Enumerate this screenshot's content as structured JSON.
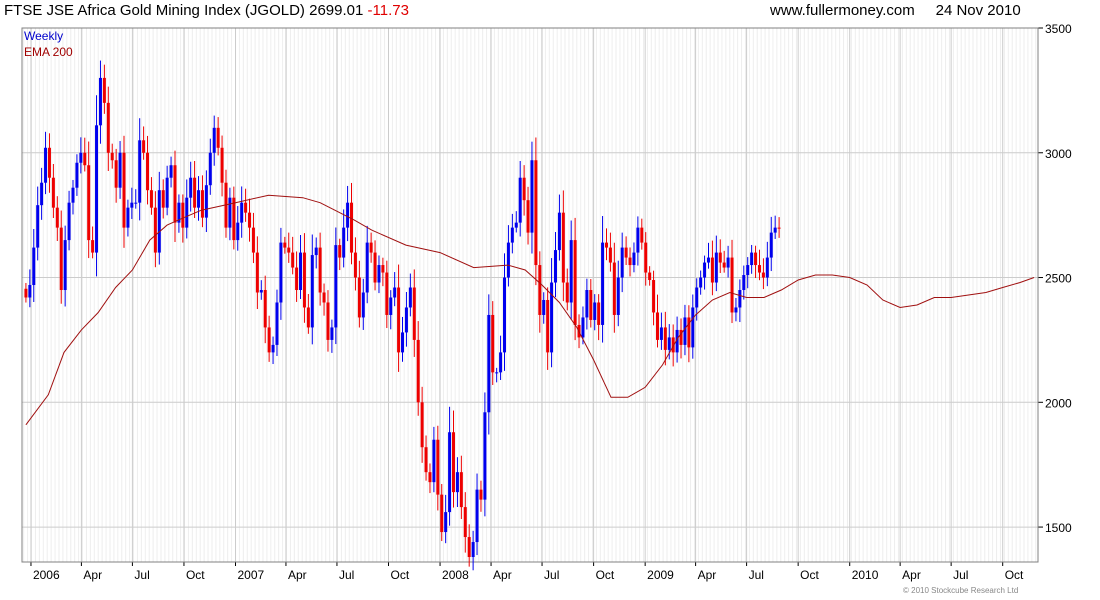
{
  "header": {
    "title": "FTSE JSE Africa Gold Mining Index (JGOLD)",
    "last": "2699.01",
    "change": "-11.73",
    "site": "www.fullermoney.com",
    "date": "24 Nov 2010"
  },
  "legend": {
    "weekly": "Weekly",
    "ema": "EMA 200"
  },
  "copyright": "© 2010 Stockcube Research Ltd",
  "colors": {
    "up": "#0000ee",
    "down": "#ee0000",
    "ema": "#a01010",
    "grid": "#cccccc",
    "border": "#808080"
  },
  "chart_data": {
    "type": "candlestick",
    "grid": true,
    "ylim": [
      1360,
      3500
    ],
    "xlim": [
      "2005-12-16",
      "2010-12-03"
    ],
    "yticks": [
      1500,
      2000,
      2500,
      3000,
      3500
    ],
    "xticks": [
      {
        "label": "2006",
        "date": "2006-01-01"
      },
      {
        "label": "Apr",
        "date": "2006-04-01"
      },
      {
        "label": "Jul",
        "date": "2006-07-01"
      },
      {
        "label": "Oct",
        "date": "2006-10-01"
      },
      {
        "label": "2007",
        "date": "2007-01-01"
      },
      {
        "label": "Apr",
        "date": "2007-04-01"
      },
      {
        "label": "Jul",
        "date": "2007-07-01"
      },
      {
        "label": "Oct",
        "date": "2007-10-01"
      },
      {
        "label": "2008",
        "date": "2008-01-01"
      },
      {
        "label": "Apr",
        "date": "2008-04-01"
      },
      {
        "label": "Jul",
        "date": "2008-07-01"
      },
      {
        "label": "Oct",
        "date": "2008-10-01"
      },
      {
        "label": "2009",
        "date": "2009-01-01"
      },
      {
        "label": "Apr",
        "date": "2009-04-01"
      },
      {
        "label": "Jul",
        "date": "2009-07-01"
      },
      {
        "label": "Oct",
        "date": "2009-10-01"
      },
      {
        "label": "2010",
        "date": "2010-01-01"
      },
      {
        "label": "Apr",
        "date": "2010-04-01"
      },
      {
        "label": "Jul",
        "date": "2010-07-01"
      },
      {
        "label": "Oct",
        "date": "2010-10-01"
      }
    ],
    "weekly": {
      "interval": "weekly",
      "start": "2005-12-23",
      "close": [
        2420,
        2470,
        2620,
        2790,
        2880,
        3020,
        2900,
        2780,
        2700,
        2450,
        2650,
        2800,
        2860,
        2960,
        3000,
        2950,
        2650,
        2600,
        3110,
        3300,
        3200,
        3000,
        2970,
        2860,
        3000,
        2700,
        2780,
        2800,
        2800,
        3050,
        3000,
        2850,
        2780,
        2600,
        2850,
        2780,
        2900,
        2950,
        2720,
        2800,
        2700,
        2820,
        2900,
        2780,
        2850,
        2740,
        2870,
        3000,
        3100,
        3020,
        2880,
        2700,
        2820,
        2650,
        2720,
        2800,
        2760,
        2700,
        2600,
        2440,
        2450,
        2300,
        2200,
        2230,
        2400,
        2640,
        2620,
        2600,
        2540,
        2450,
        2600,
        2380,
        2300,
        2590,
        2620,
        2440,
        2400,
        2250,
        2300,
        2630,
        2580,
        2700,
        2800,
        2600,
        2500,
        2340,
        2440,
        2640,
        2600,
        2480,
        2550,
        2520,
        2350,
        2420,
        2460,
        2200,
        2280,
        2380,
        2460,
        2250,
        2000,
        1820,
        1720,
        1680,
        1850,
        1630,
        1480,
        1560,
        1880,
        1640,
        1720,
        1580,
        1460,
        1380,
        1440,
        1650,
        1610,
        1960,
        2350,
        2120,
        2120,
        2200,
        2500,
        2640,
        2700,
        2720,
        2900,
        2810,
        2680,
        2970,
        2550,
        2350,
        2410,
        2200,
        2480,
        2610,
        2760,
        2480,
        2400,
        2650,
        2310,
        2260,
        2340,
        2450,
        2330,
        2400,
        2310,
        2640,
        2620,
        2560,
        2350,
        2500,
        2620,
        2580,
        2550,
        2600,
        2700,
        2640,
        2520,
        2490,
        2360,
        2250,
        2300,
        2210,
        2260,
        2200,
        2290,
        2230,
        2340,
        2220,
        2380,
        2460,
        2500,
        2560,
        2580,
        2480,
        2600,
        2560,
        2540,
        2580,
        2360,
        2380,
        2450,
        2510,
        2550,
        2600,
        2550,
        2520,
        2500,
        2580,
        2680,
        2700,
        2699
      ]
    },
    "ema200": {
      "points": [
        [
          "2005-12-23",
          1910
        ],
        [
          "2006-02-01",
          2030
        ],
        [
          "2006-03-01",
          2200
        ],
        [
          "2006-04-01",
          2290
        ],
        [
          "2006-05-01",
          2360
        ],
        [
          "2006-06-01",
          2460
        ],
        [
          "2006-07-01",
          2530
        ],
        [
          "2006-08-01",
          2650
        ],
        [
          "2006-09-01",
          2710
        ],
        [
          "2006-10-01",
          2740
        ],
        [
          "2006-11-01",
          2770
        ],
        [
          "2007-01-01",
          2800
        ],
        [
          "2007-03-01",
          2830
        ],
        [
          "2007-05-01",
          2820
        ],
        [
          "2007-06-01",
          2800
        ],
        [
          "2007-08-01",
          2730
        ],
        [
          "2007-09-01",
          2690
        ],
        [
          "2007-11-01",
          2630
        ],
        [
          "2008-01-01",
          2600
        ],
        [
          "2008-03-01",
          2540
        ],
        [
          "2008-05-01",
          2550
        ],
        [
          "2008-06-01",
          2530
        ],
        [
          "2008-07-01",
          2470
        ],
        [
          "2008-08-01",
          2400
        ],
        [
          "2008-09-01",
          2300
        ],
        [
          "2008-10-01",
          2170
        ],
        [
          "2008-11-01",
          2020
        ],
        [
          "2008-12-01",
          2020
        ],
        [
          "2009-01-01",
          2060
        ],
        [
          "2009-02-01",
          2150
        ],
        [
          "2009-03-01",
          2260
        ],
        [
          "2009-04-01",
          2350
        ],
        [
          "2009-05-01",
          2410
        ],
        [
          "2009-06-01",
          2440
        ],
        [
          "2009-07-01",
          2420
        ],
        [
          "2009-08-01",
          2420
        ],
        [
          "2009-09-01",
          2450
        ],
        [
          "2009-10-01",
          2490
        ],
        [
          "2009-11-01",
          2510
        ],
        [
          "2009-12-01",
          2510
        ],
        [
          "2010-01-01",
          2500
        ],
        [
          "2010-02-01",
          2470
        ],
        [
          "2010-03-01",
          2410
        ],
        [
          "2010-04-01",
          2380
        ],
        [
          "2010-05-01",
          2390
        ],
        [
          "2010-06-01",
          2420
        ],
        [
          "2010-07-01",
          2420
        ],
        [
          "2010-08-01",
          2430
        ],
        [
          "2010-09-01",
          2440
        ],
        [
          "2010-10-01",
          2460
        ],
        [
          "2010-11-01",
          2480
        ],
        [
          "2010-11-26",
          2500
        ]
      ]
    }
  }
}
